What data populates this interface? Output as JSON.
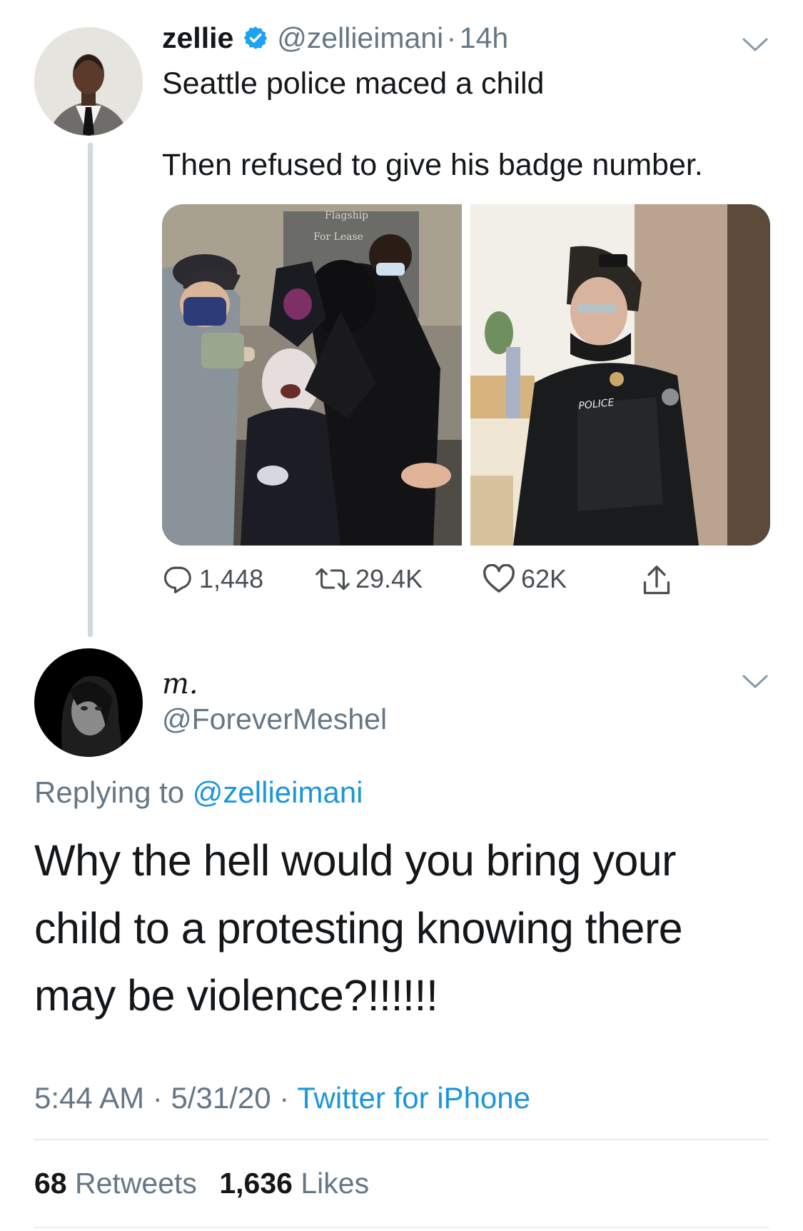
{
  "tweet": {
    "author_name": "zellie",
    "author_handle": "@zellieimani",
    "separator": "·",
    "time": "14h",
    "text_line1": "Seattle police maced a child",
    "text_line2": "Then refused to give his badge number.",
    "media_text": {
      "sign_top": "Flagship",
      "sign_mid": "For Lease",
      "police_label": "POLICE"
    },
    "actions": {
      "replies": "1,448",
      "retweets": "29.4K",
      "likes": "62K"
    }
  },
  "reply": {
    "author_name": "m.",
    "author_handle": "@ForeverMeshel",
    "replying_prefix": "Replying to",
    "replying_handle": "@zellieimani",
    "text_line1": "Why the hell would you bring your",
    "text_line2": "child to a protesting knowing there",
    "text_line3": "may be violence?!!!!!!",
    "time": "5:44 AM",
    "separator": "·",
    "date": "5/31/20",
    "source": "Twitter for iPhone",
    "retweets_count": "68",
    "retweets_label": "Retweets",
    "likes_count": "1,636",
    "likes_label": "Likes"
  },
  "colors": {
    "link": "#1b95e0",
    "secondary_text": "#657786",
    "verified": "#1da1f2"
  },
  "icons": [
    "chevron-down-icon",
    "verified-badge-icon",
    "reply-icon",
    "retweet-icon",
    "like-icon",
    "share-icon"
  ]
}
